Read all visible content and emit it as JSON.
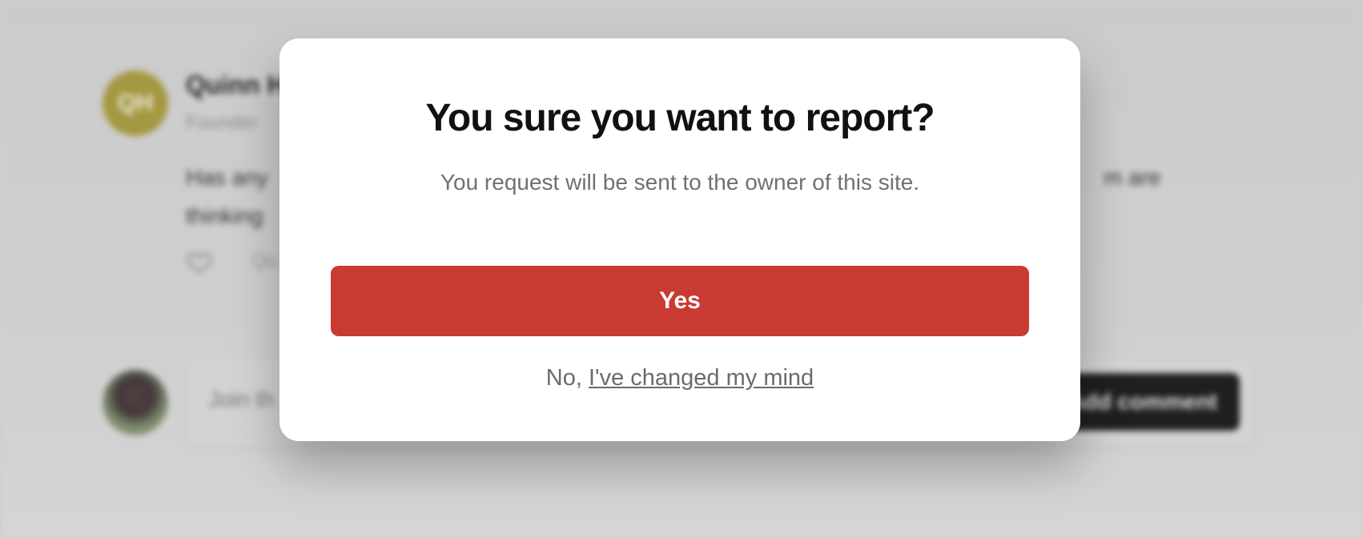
{
  "background": {
    "comment": {
      "avatar_initials": "QH",
      "author_name": "Quinn H",
      "author_role": "Founder",
      "body_start": "Has any",
      "body_line2": "thinking",
      "body_tail": "m are",
      "reply_stub": "Qu"
    },
    "composer": {
      "input_placeholder": "Join th",
      "add_comment_label": "Add comment"
    }
  },
  "modal": {
    "title": "You sure you want to report?",
    "subtitle": "You request will be sent to the owner of this site.",
    "yes_label": "Yes",
    "no_prefix": "No,",
    "no_link": "I've changed my mind"
  },
  "colors": {
    "danger": "#c93a32",
    "avatar_bg": "#a89a3a",
    "muted_text": "#707070"
  },
  "icons": {
    "like": "heart-outline-icon"
  }
}
